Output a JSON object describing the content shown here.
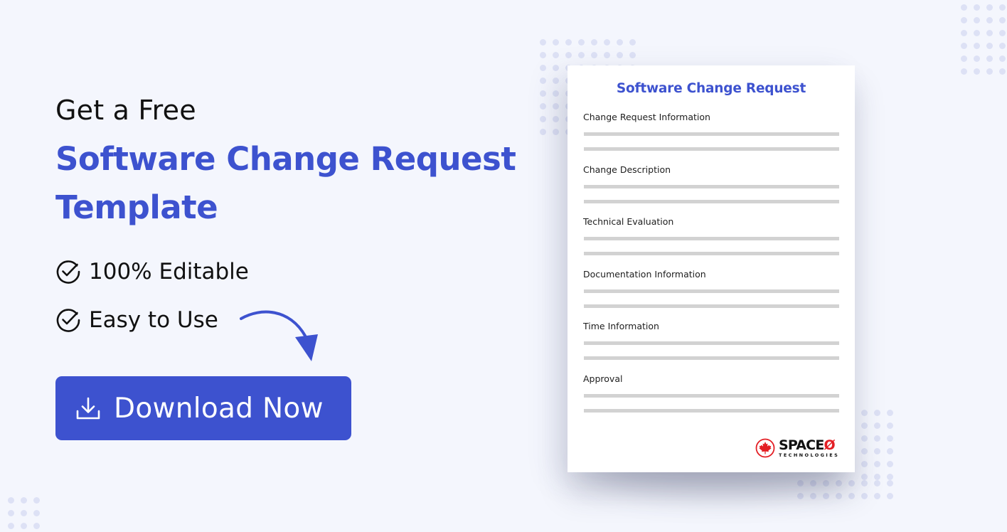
{
  "hero": {
    "intro": "Get a Free",
    "headline_line1": "Software Change Request",
    "headline_line2": "Template",
    "features": [
      {
        "icon": "check-circle-icon",
        "label": "100% Editable"
      },
      {
        "icon": "check-circle-icon",
        "label": "Easy to Use"
      }
    ],
    "cta": {
      "icon": "download-icon",
      "label": "Download Now"
    }
  },
  "document": {
    "title": "Software Change Request",
    "sections": [
      {
        "label": "Change Request Information"
      },
      {
        "label": "Change Description"
      },
      {
        "label": "Technical Evaluation"
      },
      {
        "label": "Documentation Information"
      },
      {
        "label": "Time Information"
      },
      {
        "label": "Approval"
      }
    ],
    "logo": {
      "icon": "maple-leaf-icon",
      "name": "SPACE",
      "name_suffix": "Ø",
      "tagline": "TECHNOLOGIES"
    }
  },
  "colors": {
    "background": "#f4f6fd",
    "brand_blue": "#3d52cf",
    "logo_red": "#e31e24",
    "placeholder_line": "#d2d2d2",
    "dot_pattern": "#dde1f5"
  }
}
